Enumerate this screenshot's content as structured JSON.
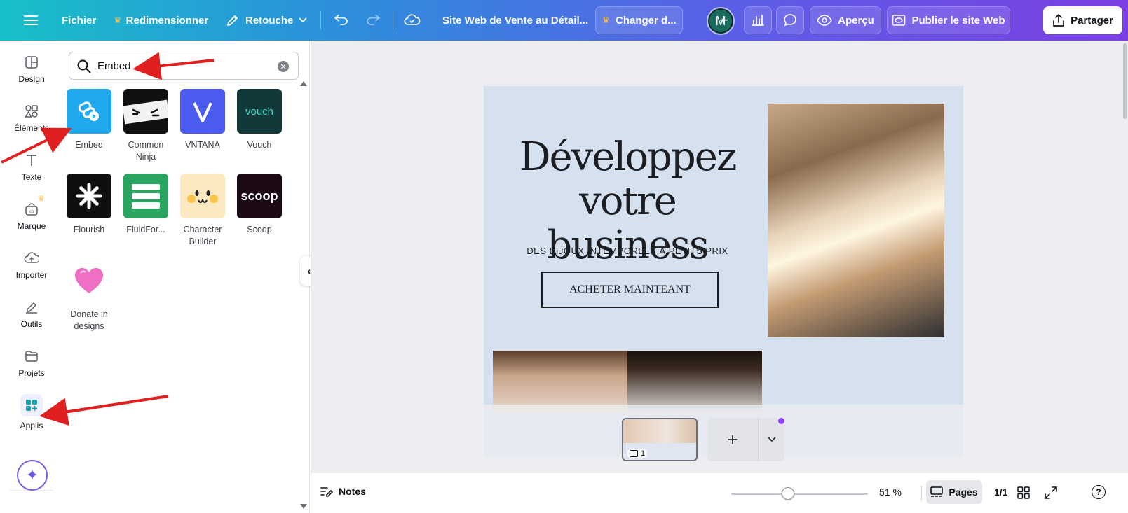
{
  "topbar": {
    "file": "Fichier",
    "resize": "Redimensionner",
    "edit": "Retouche",
    "doc_title": "Site Web de Vente au Détail...",
    "change": "Changer d...",
    "avatar_initial": "M",
    "preview": "Aperçu",
    "publish": "Publier le site Web",
    "share": "Partager",
    "icons": [
      "menu-icon",
      "crown-icon",
      "pencil-icon",
      "chevron-down-icon",
      "undo-icon",
      "redo-icon",
      "cloud-check-icon",
      "plus-icon",
      "chart-icon",
      "comment-icon",
      "eye-icon",
      "website-icon",
      "share-icon"
    ]
  },
  "rail": {
    "items": [
      {
        "label": "Design",
        "icon": "design-icon"
      },
      {
        "label": "Éléments",
        "icon": "elements-icon"
      },
      {
        "label": "Texte",
        "icon": "text-icon"
      },
      {
        "label": "Marque",
        "icon": "brand-icon"
      },
      {
        "label": "Importer",
        "icon": "upload-cloud-icon"
      },
      {
        "label": "Outils",
        "icon": "tools-icon"
      },
      {
        "label": "Projets",
        "icon": "folder-icon"
      },
      {
        "label": "Applis",
        "icon": "apps-icon"
      }
    ],
    "magic_icon": "sparkle-icon"
  },
  "panel": {
    "search_value": "Embed",
    "apps": [
      {
        "name": "Embed",
        "label": "Embed",
        "logo_text": "",
        "bg": "#20a9ef"
      },
      {
        "name": "Common Ninja",
        "label": "Common Ninja",
        "logo_text": "",
        "bg": "#111111"
      },
      {
        "name": "VNTANA",
        "label": "VNTANA",
        "logo_text": "",
        "bg": "#4c5cf0"
      },
      {
        "name": "Vouch",
        "label": "Vouch",
        "logo_text": "vouch",
        "bg": "#12393a"
      },
      {
        "name": "Flourish",
        "label": "Flourish",
        "logo_text": "",
        "bg": "#0f0f0f"
      },
      {
        "name": "FluidFor...",
        "label": "FluidFor...",
        "logo_text": "",
        "bg": "#2aa561"
      },
      {
        "name": "Character Builder",
        "label": "Character Builder",
        "logo_text": "",
        "bg": "#fde9bf"
      },
      {
        "name": "Scoop",
        "label": "Scoop",
        "logo_text": "scoop",
        "bg": "#1b0a14"
      },
      {
        "name": "Donate in designs",
        "label": "Donate in designs",
        "logo_text": "",
        "bg": "#ffffff"
      }
    ]
  },
  "canvas": {
    "hero_title": "Développez votre business",
    "hero_subtitle": "DES BIJOUX INTEMPORELS À PETITS PRIX",
    "hero_button": "ACHETER MAINTEANT",
    "page_number": "1"
  },
  "bottombar": {
    "notes": "Notes",
    "zoom": "51 %",
    "zoom_fraction": 0.51,
    "pages": "Pages",
    "page_count": "1/1"
  },
  "colors": {
    "accent": "#8b3dff",
    "annotation": "#e02020"
  }
}
